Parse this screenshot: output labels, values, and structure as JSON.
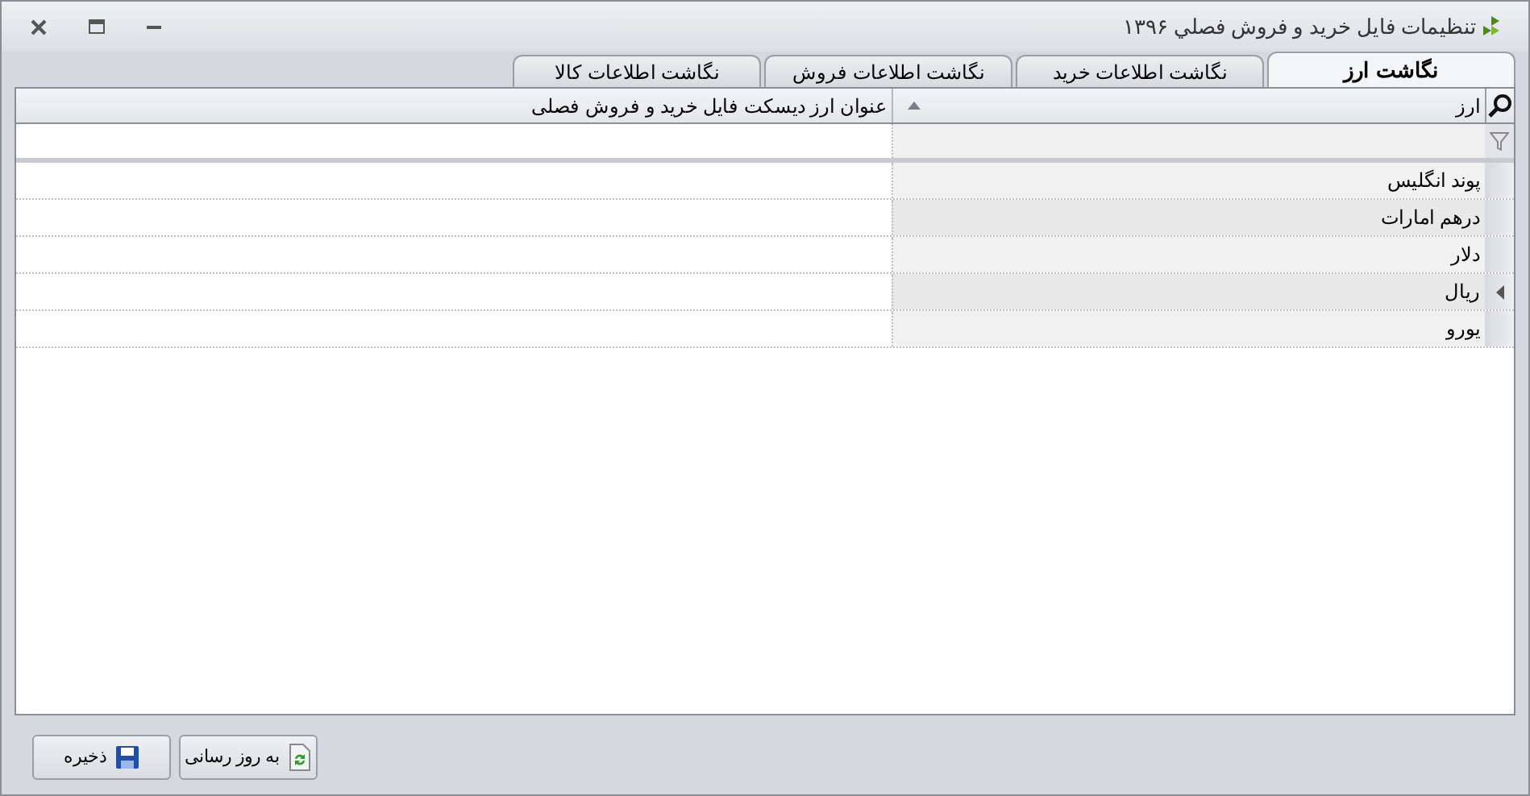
{
  "window": {
    "title": "تنظیمات فایل خرید و فروش فصلي ۱۳۹۶"
  },
  "tabs": [
    {
      "label": "نگاشت ارز",
      "selected": true
    },
    {
      "label": "نگاشت اطلاعات خرید",
      "selected": false
    },
    {
      "label": "نگاشت اطلاعات فروش",
      "selected": false
    },
    {
      "label": "نگاشت اطلاعات کالا",
      "selected": false
    }
  ],
  "grid": {
    "columns": [
      {
        "label": "ارز",
        "sorted": true
      },
      {
        "label": "عنوان ارز دیسکت فایل خرید و فروش فصلی",
        "sorted": false
      }
    ],
    "rows": [
      {
        "currency": "پوند انگلیس",
        "selected": false
      },
      {
        "currency": "درهم امارات",
        "selected": false
      },
      {
        "currency": "دلار",
        "selected": false
      },
      {
        "currency": "ریال",
        "selected": true
      },
      {
        "currency": "یورو",
        "selected": false
      }
    ]
  },
  "buttons": [
    {
      "label": "به روز رسانی",
      "kind": "refresh"
    },
    {
      "label": "ذخیره",
      "kind": "save"
    }
  ]
}
